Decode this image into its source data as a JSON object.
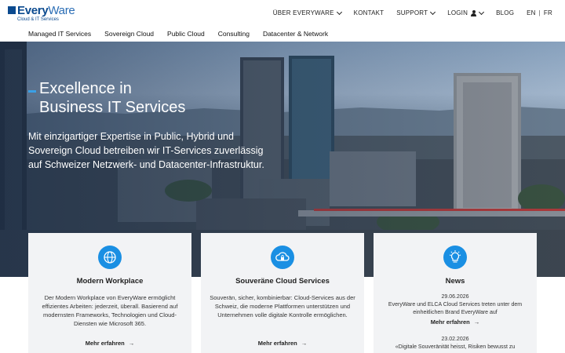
{
  "logo": {
    "name_bold": "Every",
    "name_light": "Ware",
    "tagline": "Cloud & IT Services"
  },
  "topnav": {
    "items": [
      {
        "label": "ÜBER EVERYWARE",
        "dropdown": true
      },
      {
        "label": "KONTAKT",
        "dropdown": false
      },
      {
        "label": "SUPPORT",
        "dropdown": true
      },
      {
        "label": "LOGIN",
        "dropdown": true,
        "icon": "user-icon"
      },
      {
        "label": "BLOG",
        "dropdown": false
      }
    ],
    "lang_en": "EN",
    "lang_sep": "|",
    "lang_fr": "FR"
  },
  "subnav": {
    "items": [
      "Managed IT Services",
      "Sovereign Cloud",
      "Public Cloud",
      "Consulting",
      "Datacenter & Network"
    ]
  },
  "hero": {
    "title_line1": "Excellence in",
    "title_line2": "Business IT Services",
    "text": "Mit einzigartiger Expertise in Public, Hybrid und Sovereign Cloud betreiben wir IT-Services zuverlässig auf Schweizer Netzwerk- und Datacenter-Infrastruktur."
  },
  "cards": [
    {
      "icon": "globe-icon",
      "title": "Modern Workplace",
      "text": "Der Modern Workplace von EveryWare ermöglicht effizientes Arbeiten: jederzeit, überall. Basierend auf modernsten Frameworks, Technologien und Cloud-Diensten wie Microsoft 365.",
      "link": "Mehr erfahren"
    },
    {
      "icon": "cloud-lock-icon",
      "title": "Souveräne Cloud Services",
      "text": "Souverän, sicher, kombinierbar: Cloud-Services aus der Schweiz, die moderne Plattformen unterstützen und Unternehmen volle digitale Kontrolle ermöglichen.",
      "link": "Mehr erfahren"
    }
  ],
  "news": {
    "icon": "lightbulb-icon",
    "title": "News",
    "items": [
      {
        "date": "29.06.2026",
        "text": "EveryWare und ELCA Cloud Services treten unter dem einheitlichen Brand EveryWare auf",
        "link": "Mehr erfahren"
      },
      {
        "date": "23.02.2026",
        "text": "«Digitale Souveränität heisst, Risiken bewusst zu"
      }
    ]
  },
  "arrow_glyph": "→",
  "colors": {
    "brand": "#0b4a8f",
    "accent": "#1a8fe3",
    "card_bg": "#f2f3f5"
  }
}
